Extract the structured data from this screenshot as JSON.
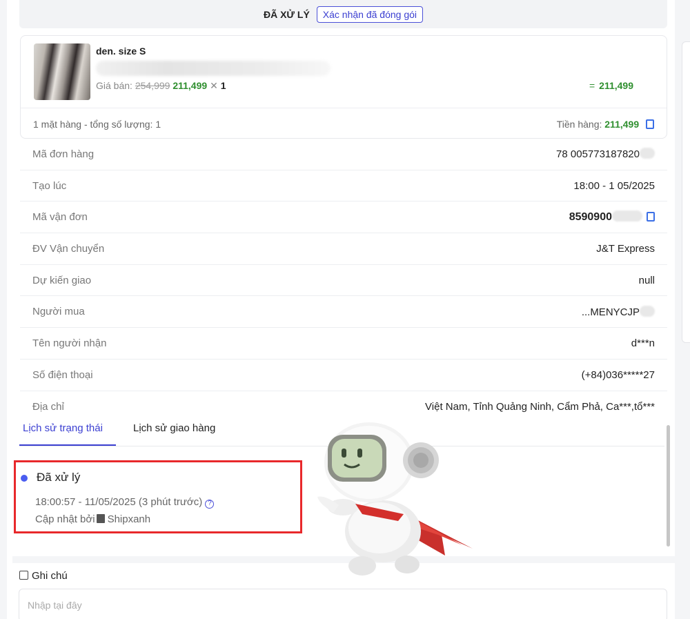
{
  "header": {
    "status": "ĐÃ XỬ LÝ",
    "confirm_button": "Xác nhận đã đóng gói"
  },
  "product": {
    "name": "den. size S",
    "price_label": "Giá bán:",
    "old_price": "254,999",
    "new_price": "211,499",
    "times": "✕",
    "quantity": "1",
    "total_eq": "=",
    "line_total": "211,499",
    "summary": "1 mặt hàng - tổng số lượng: 1",
    "goods_label": "Tiền hàng:",
    "goods_total": "211,499"
  },
  "info": [
    {
      "label": "Mã đơn hàng",
      "value": "78 005773187820"
    },
    {
      "label": "Tạo lúc",
      "value": "18:00 - 1 05/2025"
    },
    {
      "label": "Mã vận đơn",
      "value": "8590900"
    },
    {
      "label": "ĐV Vận chuyển",
      "value": "J&T Express"
    },
    {
      "label": "Dự kiến giao",
      "value": "null"
    },
    {
      "label": "Người mua",
      "value": "...MENYCJP"
    },
    {
      "label": "Tên người nhận",
      "value": "d***n"
    },
    {
      "label": "Số điện thoại",
      "value": "(+84)036*****27"
    },
    {
      "label": "Địa chỉ",
      "value": "Việt Nam, Tỉnh Quảng Ninh, Cẩm Phả, Ca***,tổ***"
    }
  ],
  "tabs": {
    "active": "Lịch sử trạng thái",
    "inactive": "Lịch sử giao hàng"
  },
  "history": {
    "title": "Đã xử lý",
    "time": "18:00:57 - 11/05/2025 (3 phút trước)",
    "updated_by_label": "Cập nhật bởi",
    "updated_by": "Shipxanh"
  },
  "notes": {
    "title": "Ghi chú",
    "placeholder": "Nhập tại đây"
  },
  "colors": {
    "accent": "#3b3fd1",
    "price_green": "#2f8f2f",
    "highlight_red": "#e8282b"
  }
}
